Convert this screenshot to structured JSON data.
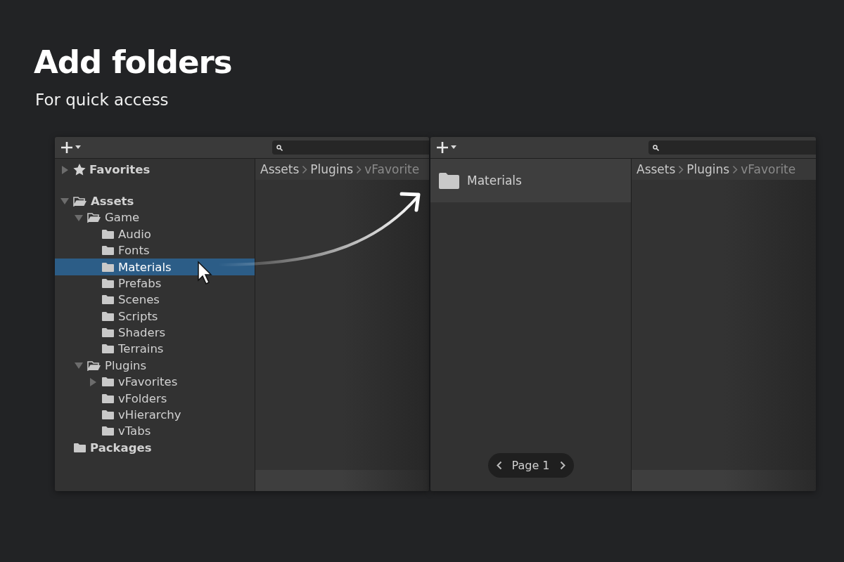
{
  "heading": {
    "title": "Add folders",
    "subtitle": "For quick access"
  },
  "left_panel": {
    "breadcrumb": [
      "Assets",
      "Plugins",
      "vFavorite"
    ],
    "tree": [
      {
        "label": "Favorites",
        "kind": "favorites",
        "expanded": false,
        "selected": false
      },
      {
        "kind": "spacer"
      },
      {
        "label": "Assets",
        "kind": "folder",
        "expanded": true,
        "selected": false,
        "children": [
          {
            "label": "Game",
            "kind": "folder",
            "expanded": true,
            "selected": false,
            "children": [
              {
                "label": "Audio",
                "kind": "folder",
                "selected": false
              },
              {
                "label": "Fonts",
                "kind": "folder",
                "selected": false
              },
              {
                "label": "Materials",
                "kind": "folder",
                "selected": true
              },
              {
                "label": "Prefabs",
                "kind": "folder",
                "selected": false
              },
              {
                "label": "Scenes",
                "kind": "folder",
                "selected": false
              },
              {
                "label": "Scripts",
                "kind": "folder",
                "selected": false
              },
              {
                "label": "Shaders",
                "kind": "folder",
                "selected": false
              },
              {
                "label": "Terrains",
                "kind": "folder",
                "selected": false
              }
            ]
          },
          {
            "label": "Plugins",
            "kind": "folder",
            "expanded": true,
            "selected": false,
            "children": [
              {
                "label": "vFavorites",
                "kind": "folder",
                "expanded": false,
                "selected": false
              },
              {
                "label": "vFolders",
                "kind": "folder",
                "selected": false
              },
              {
                "label": "vHierarchy",
                "kind": "folder",
                "selected": false
              },
              {
                "label": "vTabs",
                "kind": "folder",
                "selected": false
              }
            ]
          }
        ]
      },
      {
        "label": "Packages",
        "kind": "folder",
        "selected": false
      }
    ]
  },
  "right_panel": {
    "favorites": [
      {
        "label": "Materials",
        "selected": true
      }
    ],
    "pager": "Page 1",
    "breadcrumb": [
      "Assets",
      "Plugins",
      "vFavorite"
    ]
  }
}
